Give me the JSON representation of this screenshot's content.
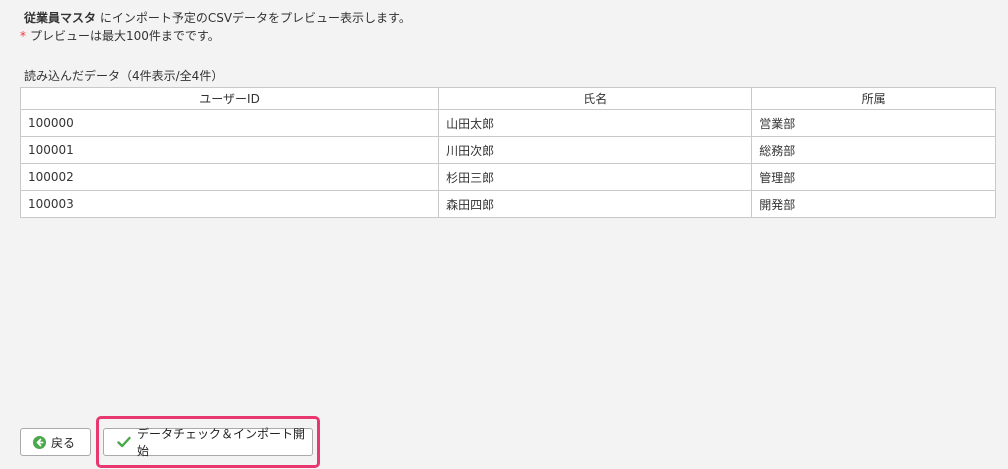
{
  "intro": {
    "master_name": "従業員マスタ",
    "message": "にインポート予定のCSVデータをプレビュー表示します。",
    "required_mark": "*",
    "note": "プレビューは最大100件までです。"
  },
  "table": {
    "caption": "読み込んだデータ（4件表示/全4件）",
    "headers": [
      "ユーザーID",
      "氏名",
      "所属"
    ],
    "rows": [
      [
        "100000",
        "山田太郎",
        "営業部"
      ],
      [
        "100001",
        "川田次郎",
        "総務部"
      ],
      [
        "100002",
        "杉田三郎",
        "管理部"
      ],
      [
        "100003",
        "森田四郎",
        "開発部"
      ]
    ]
  },
  "buttons": {
    "back_label": "戻る",
    "import_label": "データチェック＆インポート開始"
  },
  "icons": {
    "back": "arrow-left-circle-icon",
    "import": "check-icon"
  },
  "colors": {
    "highlight": "#e8386f",
    "check": "#4aa84a",
    "required": "#e8383d"
  }
}
